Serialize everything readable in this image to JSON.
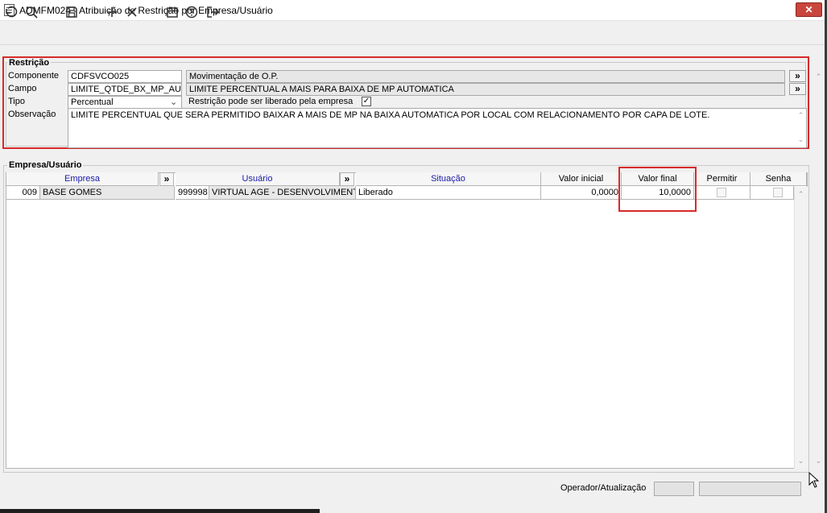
{
  "window": {
    "title": "ADMFM024 - Atribuição de Restrição por Empresa/Usuário",
    "close_label": "✕"
  },
  "toolbar": {
    "icons": [
      "undo-icon",
      "search-icon",
      "save-icon",
      "plus-icon",
      "close-icon",
      "calendar-icon",
      "help-icon",
      "exit-icon"
    ]
  },
  "restricao": {
    "legend": "Restrição",
    "componente": {
      "label": "Componente",
      "code": "CDFSVCO025",
      "description": "Movimentação de O.P."
    },
    "campo": {
      "label": "Campo",
      "code": "LIMITE_QTDE_BX_MP_AU",
      "description": "LIMITE PERCENTUAL A MAIS PARA BAIXA DE MP AUTOMATICA"
    },
    "tipo": {
      "label": "Tipo",
      "value": "Percentual",
      "liberado_label": "Restrição pode ser liberado pela empresa",
      "liberado_checked": true
    },
    "observacao": {
      "label": "Observação",
      "value": "LIMITE PERCENTUAL QUE SERA PERMITIDO BAIXAR A MAIS DE MP NA BAIXA AUTOMATICA POR LOCAL COM RELACIONAMENTO POR CAPA DE LOTE."
    },
    "more_button": "»"
  },
  "empresa_usuario": {
    "legend": "Empresa/Usuário",
    "columns": {
      "empresa": "Empresa",
      "usuario": "Usuário",
      "situacao": "Situação",
      "valor_inicial": "Valor inicial",
      "valor_final": "Valor final",
      "permitir": "Permitir",
      "senha": "Senha"
    },
    "more_button": "»",
    "rows": [
      {
        "empresa_code": "009",
        "empresa_name": "BASE GOMES",
        "usuario_code": "999998",
        "usuario_name": "VIRTUAL AGE - DESENVOLVIMENTO",
        "situacao": "Liberado",
        "valor_inicial": "0,0000",
        "valor_final": "10,0000",
        "permitir": false,
        "senha": false
      }
    ]
  },
  "footer": {
    "operador_label": "Operador/Atualização"
  },
  "colors": {
    "highlight": "#d82a2a",
    "header_blue": "#1a1aa6",
    "close_button": "#c9463d"
  }
}
